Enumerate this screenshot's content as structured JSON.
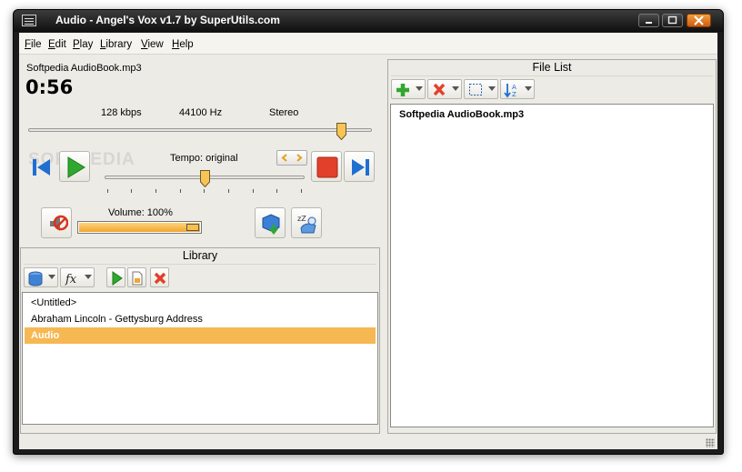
{
  "window": {
    "title": "Audio - Angel's Vox v1.7 by SuperUtils.com"
  },
  "menu": [
    {
      "label": "File",
      "mnemonic": "F",
      "rest": "ile"
    },
    {
      "label": "Edit",
      "mnemonic": "E",
      "rest": "dit"
    },
    {
      "label": "Play",
      "mnemonic": "P",
      "rest": "lay"
    },
    {
      "label": "Library",
      "mnemonic": "L",
      "rest": "ibrary"
    },
    {
      "label": "View",
      "mnemonic": "V",
      "rest": "iew"
    },
    {
      "label": "Help",
      "mnemonic": "H",
      "rest": "elp"
    }
  ],
  "player": {
    "file_name": "Softpedia AudioBook.mp3",
    "time": "0:56",
    "bitrate": "128 kbps",
    "sample_rate": "44100 Hz",
    "channels": "Stereo",
    "position_fraction": 0.91,
    "tempo_label": "Tempo: original",
    "tempo_fraction": 0.5,
    "volume_label": "Volume: 100%",
    "volume_fraction": 1.0
  },
  "library": {
    "title": "Library",
    "items": [
      {
        "label": "<Untitled>",
        "selected": false
      },
      {
        "label": "Abraham Lincoln - Gettysburg Address",
        "selected": false
      },
      {
        "label": "Audio",
        "selected": true
      }
    ]
  },
  "file_list": {
    "title": "File List",
    "items": [
      {
        "label": "Softpedia AudioBook.mp3"
      }
    ]
  },
  "watermark": "SOFTPEDIA",
  "colors": {
    "accent_orange": "#f6b853",
    "play_green": "#2fa82f",
    "stop_red": "#e2402a",
    "nav_blue": "#1f6fd1"
  },
  "icons": {
    "previous": "skip-back-icon",
    "play": "play-icon",
    "stop": "stop-icon",
    "next": "skip-forward-icon",
    "mute": "speaker-mute-icon",
    "export": "export-icon",
    "sleep": "sleep-icon",
    "add": "add-icon",
    "remove": "remove-icon",
    "select": "select-icon",
    "sort": "sort-az-icon",
    "database": "database-icon",
    "function": "function-icon",
    "new_document": "new-document-icon",
    "delete": "delete-icon"
  }
}
